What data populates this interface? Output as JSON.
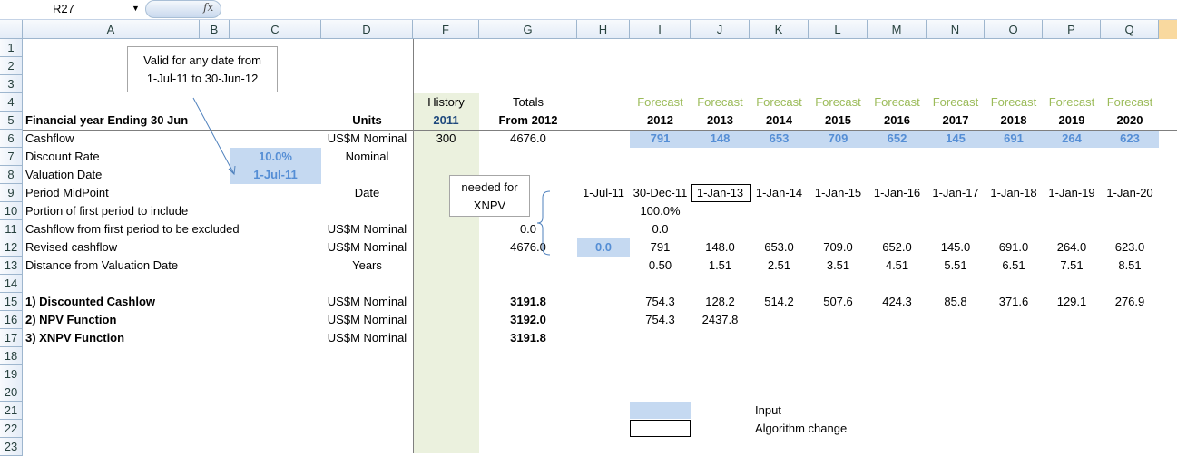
{
  "formula_bar": {
    "name_box": "R27",
    "fx_label": "fx",
    "formula": ""
  },
  "columns": [
    "A",
    "B",
    "C",
    "D",
    "F",
    "G",
    "H",
    "I",
    "J",
    "K",
    "L",
    "M",
    "N",
    "O",
    "P",
    "Q"
  ],
  "rows": [
    "1",
    "2",
    "3",
    "4",
    "5",
    "6",
    "7",
    "8",
    "9",
    "10",
    "11",
    "12",
    "13",
    "14",
    "15",
    "16",
    "17",
    "18",
    "19",
    "20",
    "21",
    "22",
    "23"
  ],
  "cells": {
    "F4": "History",
    "G4": "Totals",
    "I4": "Forecast",
    "J4": "Forecast",
    "K4": "Forecast",
    "L4": "Forecast",
    "M4": "Forecast",
    "N4": "Forecast",
    "O4": "Forecast",
    "P4": "Forecast",
    "Q4": "Forecast",
    "A5": "Financial year Ending 30 Jun",
    "D5": "Units",
    "F5": "2011",
    "G5": "From 2012",
    "I5": "2012",
    "J5": "2013",
    "K5": "2014",
    "L5": "2015",
    "M5": "2016",
    "N5": "2017",
    "O5": "2018",
    "P5": "2019",
    "Q5": "2020",
    "A6": "Cashflow",
    "D6": "US$M Nominal",
    "F6": "300",
    "G6": "4676.0",
    "I6": "791",
    "J6": "148",
    "K6": "653",
    "L6": "709",
    "M6": "652",
    "N6": "145",
    "O6": "691",
    "P6": "264",
    "Q6": "623",
    "A7": "Discount Rate",
    "C7": "10.0%",
    "D7": "Nominal",
    "A8": "Valuation Date",
    "C8": "1-Jul-11",
    "A9": "Period MidPoint",
    "D9": "Date",
    "H9": "1-Jul-11",
    "I9": "30-Dec-11",
    "J9": "1-Jan-13",
    "K9": "1-Jan-14",
    "L9": "1-Jan-15",
    "M9": "1-Jan-16",
    "N9": "1-Jan-17",
    "O9": "1-Jan-18",
    "P9": "1-Jan-19",
    "Q9": "1-Jan-20",
    "A10": "Portion of first period to include",
    "I10": "100.0%",
    "A11": "Cashflow from first period to be excluded",
    "D11": "US$M Nominal",
    "G11": "0.0",
    "I11": "0.0",
    "A12": "Revised cashflow",
    "D12": "US$M Nominal",
    "G12": "4676.0",
    "H12": "0.0",
    "I12": "791",
    "J12": "148.0",
    "K12": "653.0",
    "L12": "709.0",
    "M12": "652.0",
    "N12": "145.0",
    "O12": "691.0",
    "P12": "264.0",
    "Q12": "623.0",
    "A13": "Distance from Valuation Date",
    "D13": "Years",
    "I13": "0.50",
    "J13": "1.51",
    "K13": "2.51",
    "L13": "3.51",
    "M13": "4.51",
    "N13": "5.51",
    "O13": "6.51",
    "P13": "7.51",
    "Q13": "8.51",
    "A15": "1) Discounted Cashlow",
    "D15": "US$M Nominal",
    "G15": "3191.8",
    "I15": "754.3",
    "J15": "128.2",
    "K15": "514.2",
    "L15": "507.6",
    "M15": "424.3",
    "N15": "85.8",
    "O15": "371.6",
    "P15": "129.1",
    "Q15": "276.9",
    "A16": "2) NPV Function",
    "D16": "US$M Nominal",
    "G16": "3192.0",
    "I16": "754.3",
    "J16": "2437.8",
    "A17": "3) XNPV Function",
    "D17": "US$M Nominal",
    "G17": "3191.8",
    "K21": "Input",
    "K22": "Algorithm change"
  },
  "callouts": {
    "valid_range_line1": "Valid for any date from",
    "valid_range_line2": "1-Jul-11 to 30-Jun-12",
    "xnpv_line1": "needed for",
    "xnpv_line2": "XNPV"
  },
  "colors": {
    "input_fill": "#c5d9f1",
    "history_fill": "#ebf1de",
    "forecast_text": "#9bbb59",
    "input_text": "#558ed5"
  }
}
